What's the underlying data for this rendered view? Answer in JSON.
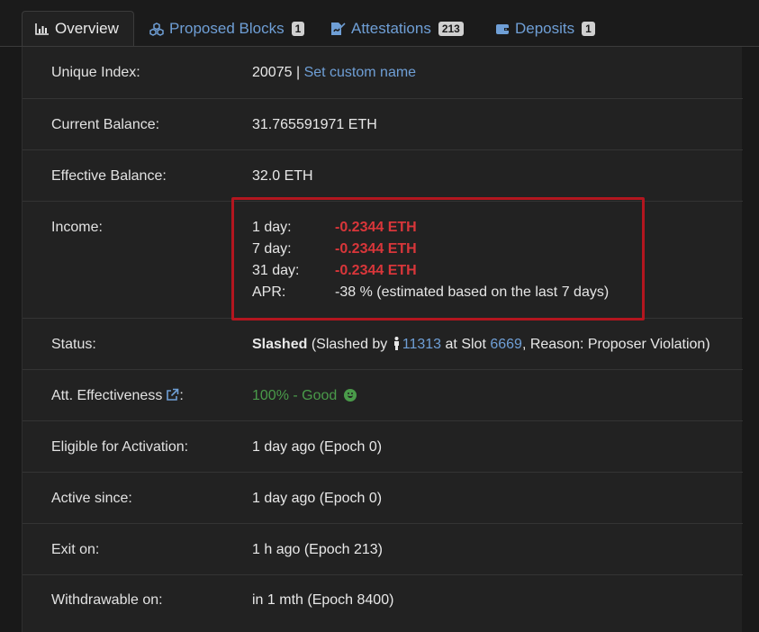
{
  "tabs": [
    {
      "label": "Overview",
      "badge": "",
      "icon": "chart-icon",
      "active": true
    },
    {
      "label": "Proposed Blocks",
      "badge": "1",
      "icon": "cubes-icon",
      "active": false
    },
    {
      "label": "Attestations",
      "badge": "213",
      "icon": "signature-icon",
      "active": false
    },
    {
      "label": "Deposits",
      "badge": "1",
      "icon": "wallet-icon",
      "active": false
    }
  ],
  "rows": {
    "unique_index": {
      "label": "Unique Index:",
      "value": "20075",
      "separator": "|",
      "link": "Set custom name"
    },
    "current_balance": {
      "label": "Current Balance:",
      "value": "31.765591971 ETH"
    },
    "effective_balance": {
      "label": "Effective Balance:",
      "value": "32.0 ETH"
    },
    "income": {
      "label": "Income:",
      "lines": [
        {
          "key": "1 day:",
          "value": "-0.2344 ETH"
        },
        {
          "key": "7 day:",
          "value": "-0.2344 ETH"
        },
        {
          "key": "31 day:",
          "value": "-0.2344 ETH"
        },
        {
          "key": "APR:",
          "value": "-38 % (estimated based on the last 7 days)"
        }
      ]
    },
    "status": {
      "label": "Status:",
      "state": "Slashed",
      "text_open": "(Slashed by",
      "slasher": "11313",
      "text_at": "at Slot",
      "slot": "6669",
      "text_reason": ", Reason: Proposer Violation)"
    },
    "att_effectiveness": {
      "label": "Att. Effectiveness",
      "suffix": ":",
      "value": "100% - Good"
    },
    "eligible": {
      "label": "Eligible for Activation:",
      "value": "1 day ago (Epoch 0)"
    },
    "active_since": {
      "label": "Active since:",
      "value": "1 day ago (Epoch 0)"
    },
    "exit_on": {
      "label": "Exit on:",
      "value": "1 h ago (Epoch 213)"
    },
    "withdrawable": {
      "label": "Withdrawable on:",
      "value": "in 1 mth (Epoch 8400)"
    }
  },
  "colors": {
    "link": "#6f9fd6",
    "negative": "#d9363a",
    "good": "#4a9b4a",
    "highlight_box": "#b3161f"
  }
}
